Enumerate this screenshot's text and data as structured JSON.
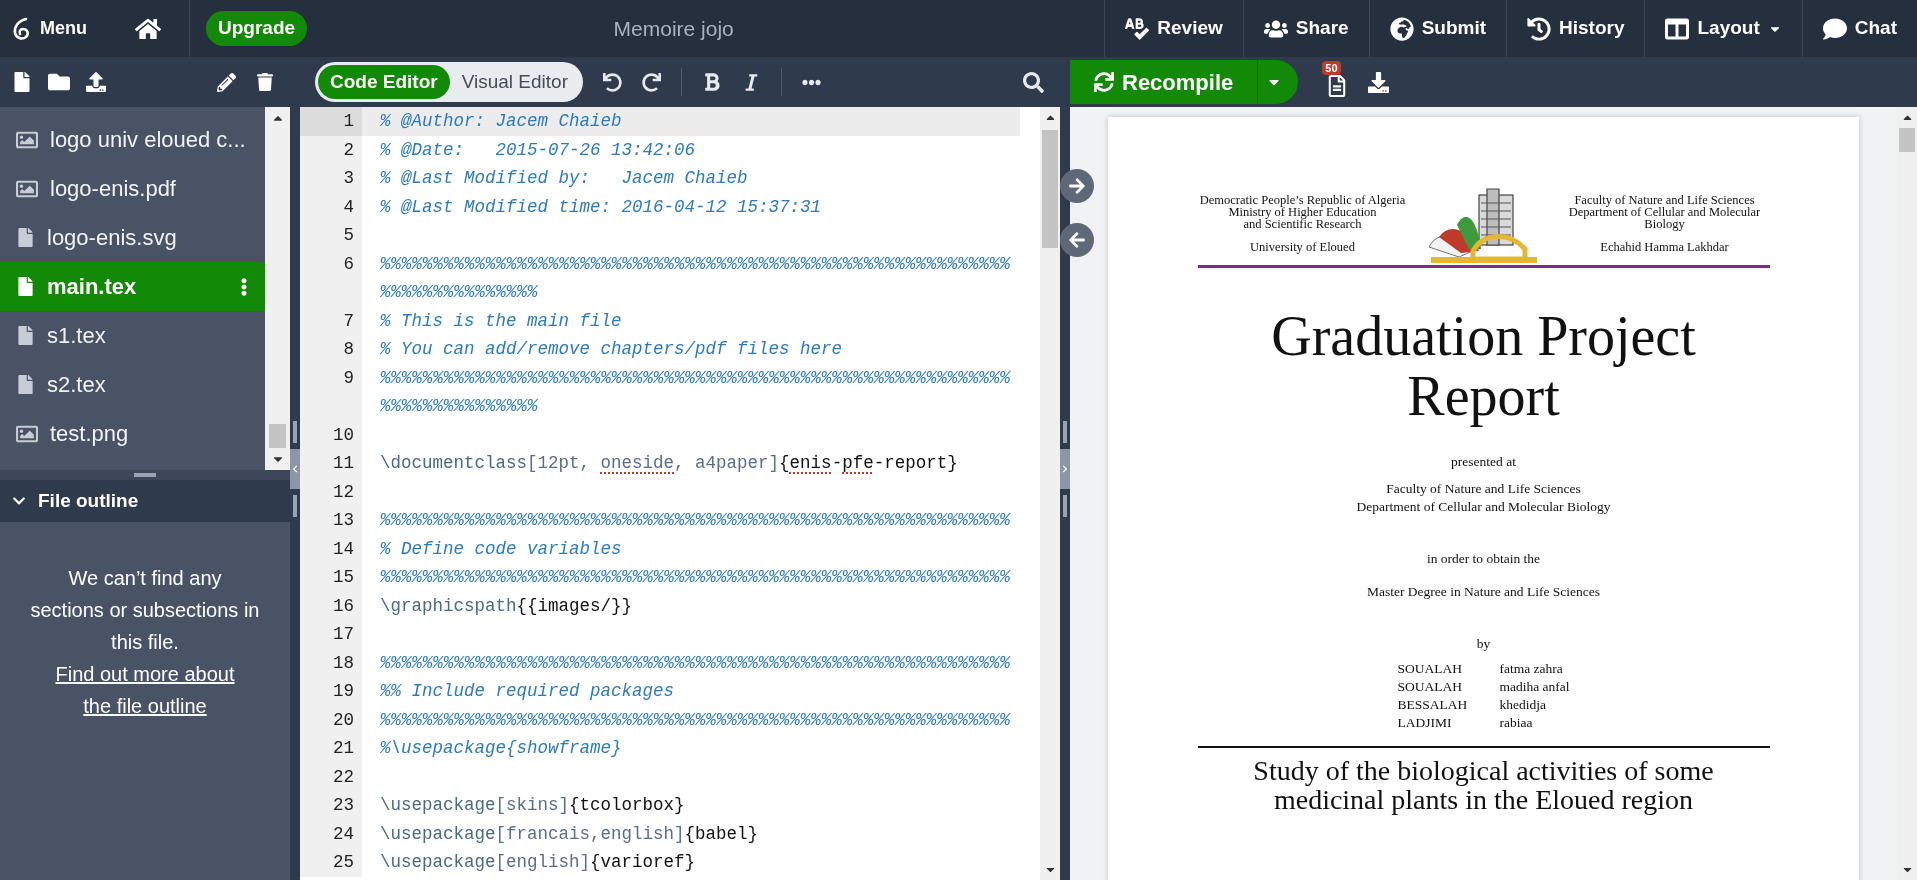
{
  "top_bar": {
    "menu": "Menu",
    "upgrade": "Upgrade",
    "title": "Memoire jojo",
    "actions": [
      {
        "kind": "review",
        "label": "Review",
        "dropdown": false
      },
      {
        "kind": "share",
        "label": "Share",
        "dropdown": false
      },
      {
        "kind": "submit",
        "label": "Submit",
        "dropdown": false
      },
      {
        "kind": "history",
        "label": "History",
        "dropdown": false
      },
      {
        "kind": "layout",
        "label": "Layout",
        "dropdown": true
      },
      {
        "kind": "chat",
        "label": "Chat",
        "dropdown": false
      }
    ]
  },
  "files": [
    {
      "kind": "image",
      "name": "logo univ eloued c...",
      "selected": false
    },
    {
      "kind": "image",
      "name": "logo-enis.pdf",
      "selected": false
    },
    {
      "kind": "file",
      "name": "logo-enis.svg",
      "selected": false
    },
    {
      "kind": "file",
      "name": "main.tex",
      "selected": true
    },
    {
      "kind": "file",
      "name": "s1.tex",
      "selected": false
    },
    {
      "kind": "file",
      "name": "s2.tex",
      "selected": false
    },
    {
      "kind": "image",
      "name": "test.png",
      "selected": false
    }
  ],
  "file_outline": {
    "title": "File outline",
    "expanded": true,
    "message": "We can’t find any sections or subsections in this file.",
    "link": "Find out more about the file outline"
  },
  "editor_modes": [
    {
      "label": "Code Editor",
      "selected": true
    },
    {
      "label": "Visual Editor",
      "selected": false
    }
  ],
  "code_lines": [
    {
      "number": "1",
      "active": true,
      "segments": [
        {
          "kind": "comment",
          "text": "% @Author: Jacem Chaieb"
        }
      ]
    },
    {
      "number": "2",
      "active": false,
      "segments": [
        {
          "kind": "comment",
          "text": "% @Date:   2015-07-26 13:42:06"
        }
      ]
    },
    {
      "number": "3",
      "active": false,
      "segments": [
        {
          "kind": "comment",
          "text": "% @Last Modified by:   Jacem Chaieb"
        }
      ]
    },
    {
      "number": "4",
      "active": false,
      "segments": [
        {
          "kind": "comment",
          "text": "% @Last Modified time: 2016-04-12 15:37:31"
        }
      ]
    },
    {
      "number": "5",
      "active": false
    },
    {
      "number": "6",
      "active": false,
      "segments": [
        {
          "kind": "comment",
          "text": "%%%%%%%%%%%%%%%%%%%%%%%%%%%%%%%%%%%%%%%%%%%%%%%%%%%%%%%%%%%%%%%%%%%%%%%%%%%"
        }
      ]
    },
    {
      "number": "7",
      "active": false,
      "segments": [
        {
          "kind": "comment",
          "text": "% This is the main file"
        }
      ]
    },
    {
      "number": "8",
      "active": false,
      "segments": [
        {
          "kind": "comment",
          "text": "% You can add/remove chapters/pdf files here"
        }
      ]
    },
    {
      "number": "9",
      "active": false,
      "segments": [
        {
          "kind": "comment",
          "text": "%%%%%%%%%%%%%%%%%%%%%%%%%%%%%%%%%%%%%%%%%%%%%%%%%%%%%%%%%%%%%%%%%%%%%%%%%%%"
        }
      ]
    },
    {
      "number": "10",
      "active": false
    },
    {
      "number": "11",
      "active": false,
      "segments": [
        {
          "kind": "command",
          "text": "\\documentclass"
        },
        {
          "kind": "option",
          "text": "[12pt, "
        },
        {
          "kind": "option",
          "text": "oneside",
          "misspelled": true
        },
        {
          "kind": "option",
          "text": ", a4paper]"
        },
        {
          "kind": "arg",
          "text": "{"
        },
        {
          "kind": "arg",
          "text": "enis",
          "misspelled": true
        },
        {
          "kind": "arg",
          "text": "-"
        },
        {
          "kind": "arg",
          "text": "pfe",
          "misspelled": true
        },
        {
          "kind": "arg",
          "text": "-report}"
        }
      ]
    },
    {
      "number": "12",
      "active": false
    },
    {
      "number": "13",
      "active": false,
      "segments": [
        {
          "kind": "comment",
          "text": "%%%%%%%%%%%%%%%%%%%%%%%%%%%%%%%%%%%%%%%%%%%%%%%%%%%%%%%%%%%%"
        }
      ]
    },
    {
      "number": "14",
      "active": false,
      "segments": [
        {
          "kind": "comment",
          "text": "% Define code variables"
        }
      ]
    },
    {
      "number": "15",
      "active": false,
      "segments": [
        {
          "kind": "comment",
          "text": "%%%%%%%%%%%%%%%%%%%%%%%%%%%%%%%%%%%%%%%%%%%%%%%%%%%%%%%%%%%%"
        }
      ]
    },
    {
      "number": "16",
      "active": false,
      "segments": [
        {
          "kind": "command",
          "text": "\\graphicspath"
        },
        {
          "kind": "arg",
          "text": "{{images/}}"
        }
      ]
    },
    {
      "number": "17",
      "active": false
    },
    {
      "number": "18",
      "active": false,
      "segments": [
        {
          "kind": "comment",
          "text": "%%%%%%%%%%%%%%%%%%%%%%%%%%%%%%%%%%%%%%%%%%%%%%%%%%%%%%%%%%%%"
        }
      ]
    },
    {
      "number": "19",
      "active": false,
      "segments": [
        {
          "kind": "comment",
          "text": "%% Include required packages"
        }
      ]
    },
    {
      "number": "20",
      "active": false,
      "segments": [
        {
          "kind": "comment",
          "text": "%%%%%%%%%%%%%%%%%%%%%%%%%%%%%%%%%%%%%%%%%%%%%%%%%%%%%%%%%%%%"
        }
      ]
    },
    {
      "number": "21",
      "active": false,
      "segments": [
        {
          "kind": "comment",
          "text": "%\\usepackage{showframe}"
        }
      ]
    },
    {
      "number": "22",
      "active": false
    },
    {
      "number": "23",
      "active": false,
      "segments": [
        {
          "kind": "command",
          "text": "\\usepackage"
        },
        {
          "kind": "option",
          "text": "[skins]"
        },
        {
          "kind": "arg",
          "text": "{tcolorbox}"
        }
      ]
    },
    {
      "number": "24",
      "active": false,
      "segments": [
        {
          "kind": "command",
          "text": "\\usepackage"
        },
        {
          "kind": "option",
          "text": "[francais,english]"
        },
        {
          "kind": "arg",
          "text": "{babel}"
        }
      ]
    },
    {
      "number": "25",
      "active": false,
      "segments": [
        {
          "kind": "command",
          "text": "\\usepackage"
        },
        {
          "kind": "option",
          "text": "[english]"
        },
        {
          "kind": "arg",
          "text": "{varioref}"
        }
      ]
    }
  ],
  "pdf_toolbar": {
    "recompile": "Recompile",
    "log_count": "50"
  },
  "pdf_page": {
    "header_left": [
      "Democratic People’s Republic of Algeria",
      "Ministry of Higher Education",
      "and Scientific Research"
    ],
    "header_left_sub": "University of Eloued",
    "header_right": [
      "Faculty of Nature and Life Sciences",
      "Department of Cellular and Molecular",
      "Biology"
    ],
    "header_right_sub": "Echahid Hamma Lakhdar",
    "title": [
      "Graduation Project",
      "Report"
    ],
    "presented": "presented at",
    "institution": [
      "Faculty of Nature and Life Sciences",
      "Department of Cellular and Molecular Biology"
    ],
    "purpose": "in order to obtain the",
    "degree": "Master Degree in Nature and Life Sciences",
    "by": "by",
    "authors": [
      {
        "surname": "SOUALAH",
        "given": "fatma zahra"
      },
      {
        "surname": "SOUALAH",
        "given": "madiha anfal"
      },
      {
        "surname": "BESSALAH",
        "given": "khedidja"
      },
      {
        "surname": "LADJIMI",
        "given": "rabiaa"
      }
    ],
    "subject": [
      "Study of the biological activities of some",
      "medicinal plants in the Eloued region"
    ]
  }
}
